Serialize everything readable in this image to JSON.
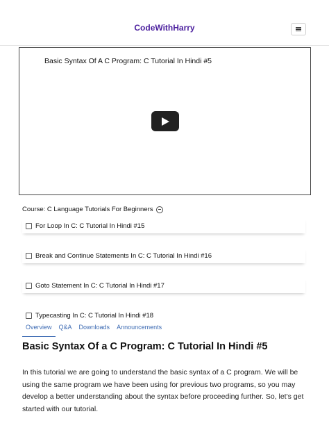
{
  "navbar": {
    "brand": "CodeWithHarry",
    "menu_icon": "hamburger-menu-icon"
  },
  "video": {
    "title": "Basic Syntax Of A C Program: C Tutorial In Hindi #5",
    "play_icon": "play-button-icon"
  },
  "course": {
    "label": "Course: C Language Tutorials For Beginners",
    "collapse_icon": "minus-circle-icon",
    "lessons": [
      {
        "title": "For Loop In C: C Tutorial In Hindi #15",
        "checked": false
      },
      {
        "title": "Break and Continue Statements In C: C Tutorial In Hindi #16",
        "checked": false
      },
      {
        "title": "Goto Statement In C: C Tutorial In Hindi #17",
        "checked": false
      },
      {
        "title": "Typecasting In C: C Tutorial In Hindi #18",
        "checked": false
      }
    ]
  },
  "tabs": [
    "Overview",
    "Q&A",
    "Downloads",
    "Announcements"
  ],
  "active_tab": "Overview",
  "main": {
    "heading": "Basic Syntax Of a C Program: C Tutorial In Hindi #5",
    "description": "In this tutorial we are going to understand the basic syntax of a C program. We will be using the same program we have been using for previous two programs, so you may develop a better understanding about the syntax before proceeding further. So, let's get started with our tutorial."
  },
  "colors": {
    "brand": "#4b1f9e",
    "tab_accent": "#3d6bb3"
  }
}
